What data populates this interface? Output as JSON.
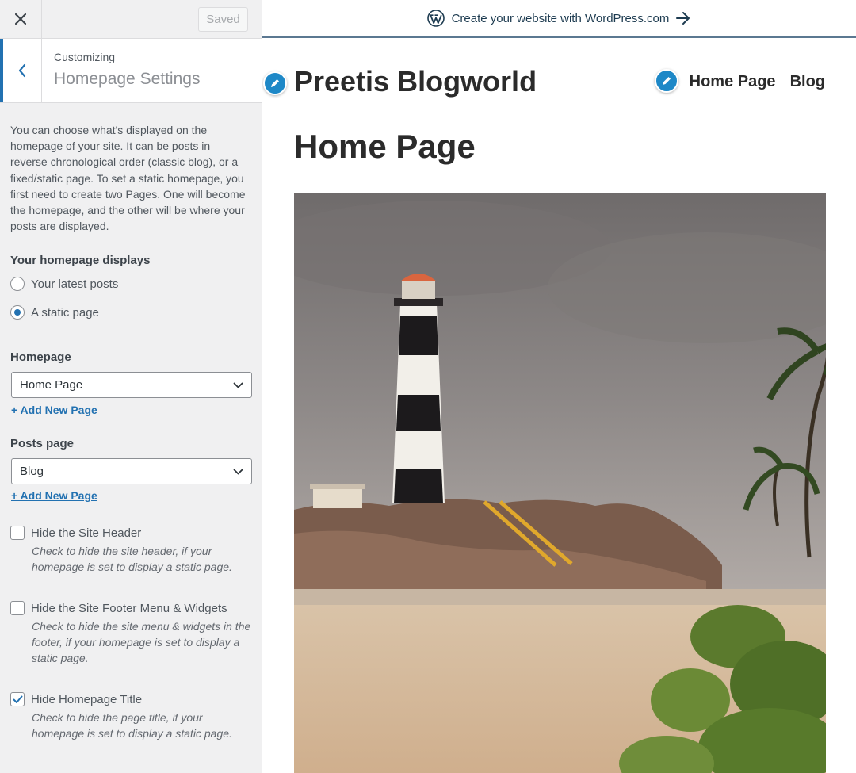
{
  "panel": {
    "saved_label": "Saved",
    "customizing_label": "Customizing",
    "section_title": "Homepage Settings",
    "description": "You can choose what's displayed on the homepage of your site. It can be posts in reverse chronological order (classic blog), or a fixed/static page. To set a static homepage, you first need to create two Pages. One will become the homepage, and the other will be where your posts are displayed.",
    "homepage_displays": {
      "title": "Your homepage displays",
      "options": [
        "Your latest posts",
        "A static page"
      ],
      "selected": "A static page"
    },
    "homepage": {
      "title": "Homepage",
      "value": "Home Page",
      "add_link": "+ Add New Page"
    },
    "posts_page": {
      "title": "Posts page",
      "value": "Blog",
      "add_link": "+ Add New Page"
    },
    "checkboxes": [
      {
        "label": "Hide the Site Header",
        "description": "Check to hide the site header, if your homepage is set to display a static page.",
        "checked": false
      },
      {
        "label": "Hide the Site Footer Menu & Widgets",
        "description": "Check to hide the site menu & widgets in the footer, if your homepage is set to display a static page.",
        "checked": false
      },
      {
        "label": "Hide Homepage Title",
        "description": "Check to hide the page title, if your homepage is set to display a static page.",
        "checked": true
      }
    ]
  },
  "preview": {
    "banner_text": "Create your website with WordPress.com",
    "site_title": "Preetis Blogworld",
    "nav": [
      "Home Page",
      "Blog"
    ],
    "page_title": "Home Page"
  },
  "colors": {
    "accent": "#2271b1",
    "pencil": "#1e88c7",
    "banner_text": "#1d3b50"
  }
}
